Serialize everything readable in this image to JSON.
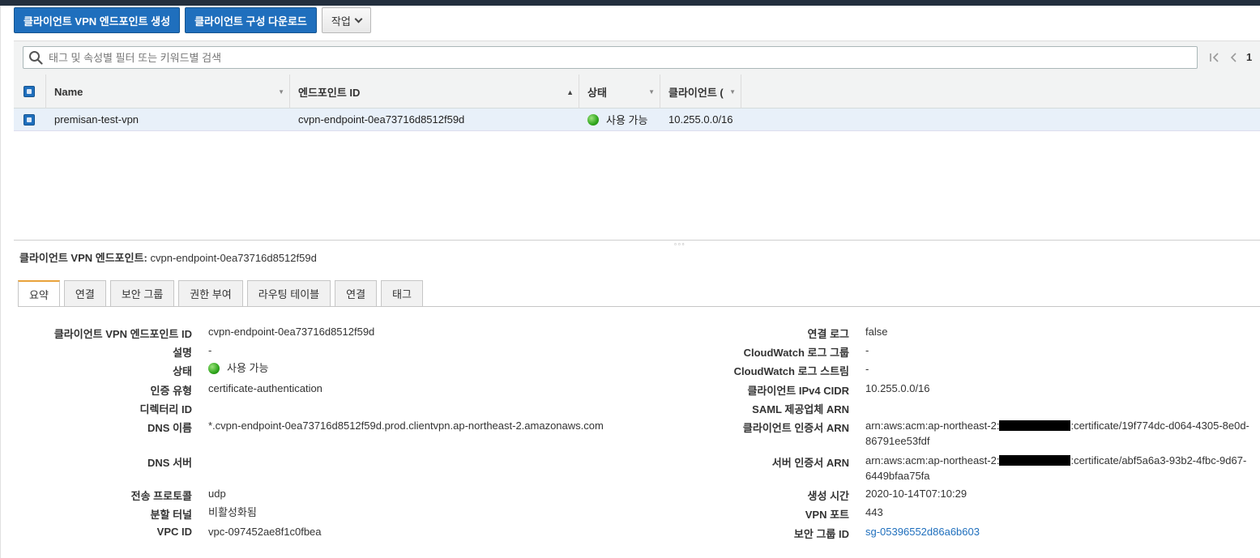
{
  "toolbar": {
    "create_label": "클라이언트 VPN 엔드포인트 생성",
    "download_label": "클라이언트 구성 다운로드",
    "actions_label": "작업"
  },
  "search": {
    "placeholder": "태그 및 속성별 필터 또는 키워드별 검색"
  },
  "pager": {
    "page": "1"
  },
  "table": {
    "columns": [
      "Name",
      "엔드포인트 ID",
      "상태",
      "클라이언트 ("
    ],
    "rows": [
      {
        "name": "premisan-test-vpn",
        "endpoint_id": "cvpn-endpoint-0ea73716d8512f59d",
        "status": "사용 가능",
        "client_cidr": "10.255.0.0/16"
      }
    ]
  },
  "details": {
    "title_label": "클라이언트 VPN 엔드포인트:",
    "title_value": "cvpn-endpoint-0ea73716d8512f59d",
    "tabs": [
      "요약",
      "연결",
      "보안 그룹",
      "권한 부여",
      "라우팅 테이블",
      "연결",
      "태그"
    ],
    "left": [
      {
        "label": "클라이언트 VPN 엔드포인트 ID",
        "value": "cvpn-endpoint-0ea73716d8512f59d"
      },
      {
        "label": "설명",
        "value": "-"
      },
      {
        "label": "상태",
        "value": "사용 가능"
      },
      {
        "label": "인증 유형",
        "value": "certificate-authentication"
      },
      {
        "label": "디렉터리 ID",
        "value": ""
      },
      {
        "label": "DNS 이름",
        "value": "*.cvpn-endpoint-0ea73716d8512f59d.prod.clientvpn.ap-northeast-2.amazonaws.com"
      },
      {
        "label": "DNS 서버",
        "value": ""
      },
      {
        "label": "전송 프로토콜",
        "value": "udp"
      },
      {
        "label": "분할 터널",
        "value": "비활성화됨"
      },
      {
        "label": "VPC ID",
        "value": "vpc-097452ae8f1c0fbea"
      }
    ],
    "right": [
      {
        "label": "연결 로그",
        "value": "false"
      },
      {
        "label": "CloudWatch 로그 그룹",
        "value": "-"
      },
      {
        "label": "CloudWatch 로그 스트림",
        "value": "-"
      },
      {
        "label": "클라이언트 IPv4 CIDR",
        "value": "10.255.0.0/16"
      },
      {
        "label": "SAML 제공업체 ARN",
        "value": ""
      },
      {
        "label": "클라이언트 인증서 ARN",
        "value_pre": "arn:aws:acm:ap-northeast-2:",
        "value_post": ":certificate/19f774dc-d064-4305-8e0d-",
        "value_line2": "86791ee53fdf"
      },
      {
        "label": "서버 인증서 ARN",
        "value_pre": "arn:aws:acm:ap-northeast-2:",
        "value_post": ":certificate/abf5a6a3-93b2-4fbc-9d67-",
        "value_line2": "6449bfaa75fa"
      },
      {
        "label": "생성 시간",
        "value": "2020-10-14T07:10:29"
      },
      {
        "label": "VPN 포트",
        "value": "443"
      },
      {
        "label": "보안 그룹 ID",
        "value": "sg-05396552d86a6b603"
      }
    ]
  }
}
